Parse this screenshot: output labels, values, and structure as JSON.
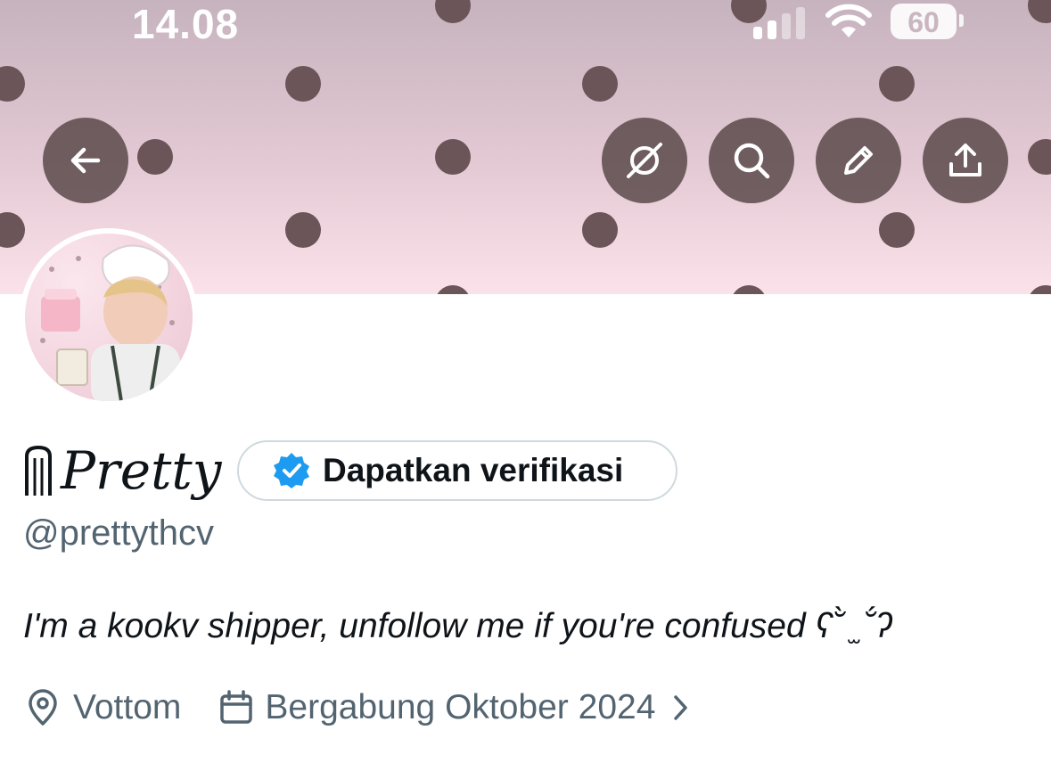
{
  "status_bar": {
    "time": "14.08",
    "battery": "60"
  },
  "header": {
    "buttons": [
      {
        "name": "back",
        "icon": "arrow-left-icon"
      },
      {
        "name": "grok",
        "icon": "grok-icon"
      },
      {
        "name": "search",
        "icon": "search-icon"
      },
      {
        "name": "edit",
        "icon": "pencil-icon"
      },
      {
        "name": "share",
        "icon": "share-icon"
      }
    ]
  },
  "profile": {
    "display_name": "Pretty",
    "verify_label": "Dapatkan verifikasi",
    "handle": "@prettythcv",
    "bio": "I'm a kookv shipper, unfollow me if you're confused ʕ˘̀ ̫ ˘́ʔ",
    "location": "Vottom",
    "joined": "Bergabung Oktober 2024"
  },
  "colors": {
    "banner_top": "#c6b3be",
    "banner_bottom": "#fbe2ea",
    "dot": "#6b5558",
    "verified_blue": "#1d9bf0",
    "secondary_text": "#536471",
    "primary_text": "#0f1419"
  }
}
